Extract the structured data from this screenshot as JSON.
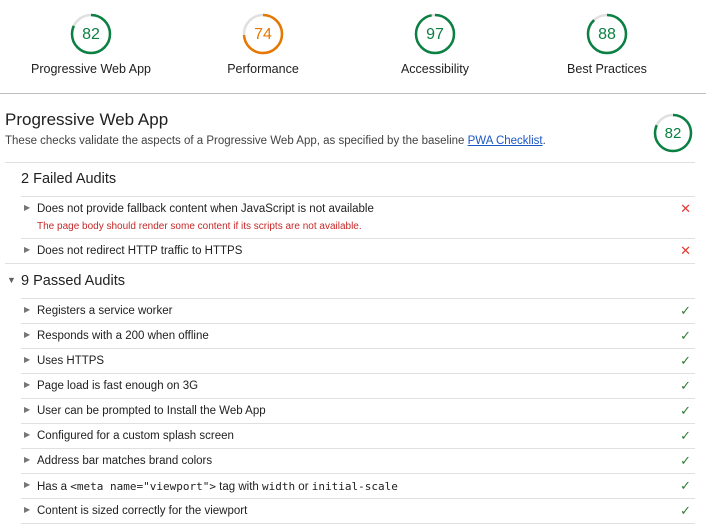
{
  "summary": {
    "gauges": [
      {
        "score": "82",
        "label": "Progressive Web App",
        "value": 0.82,
        "color": "#0b8043"
      },
      {
        "score": "74",
        "label": "Performance",
        "value": 0.74,
        "color": "#e67700"
      },
      {
        "score": "97",
        "label": "Accessibility",
        "value": 0.97,
        "color": "#0b8043"
      },
      {
        "score": "88",
        "label": "Best Practices",
        "value": 0.88,
        "color": "#0b8043"
      }
    ]
  },
  "category": {
    "title": "Progressive Web App",
    "description": "These checks validate the aspects of a Progressive Web App, as specified by the baseline ",
    "link_text": "PWA Checklist",
    "description_end": ".",
    "score": "82",
    "value": 0.82,
    "color": "#0b8043"
  },
  "failed": {
    "title": "2 Failed Audits",
    "items": [
      {
        "title": "Does not provide fallback content when JavaScript is not available",
        "sub": "The page body should render some content if its scripts are not available.",
        "mark": "✕"
      },
      {
        "title": "Does not redirect HTTP traffic to HTTPS",
        "mark": "✕"
      }
    ]
  },
  "passed": {
    "arrow": "▼",
    "title": "9 Passed Audits",
    "items": [
      {
        "title": "Registers a service worker",
        "mark": "✓"
      },
      {
        "title": "Responds with a 200 when offline",
        "mark": "✓"
      },
      {
        "title": "Uses HTTPS",
        "mark": "✓"
      },
      {
        "title": "Page load is fast enough on 3G",
        "mark": "✓"
      },
      {
        "title": "User can be prompted to Install the Web App",
        "mark": "✓"
      },
      {
        "title": "Configured for a custom splash screen",
        "mark": "✓"
      },
      {
        "title": "Address bar matches brand colors",
        "mark": "✓"
      },
      {
        "title_parts": [
          "Has a ",
          "<meta name=\"viewport\">",
          " tag with ",
          "width",
          " or ",
          "initial-scale"
        ],
        "mark": "✓"
      },
      {
        "title": "Content is sized correctly for the viewport",
        "mark": "✓"
      }
    ]
  },
  "icons": {
    "expand": "triangle-right-icon",
    "fail": "cross-icon",
    "pass": "check-icon"
  }
}
